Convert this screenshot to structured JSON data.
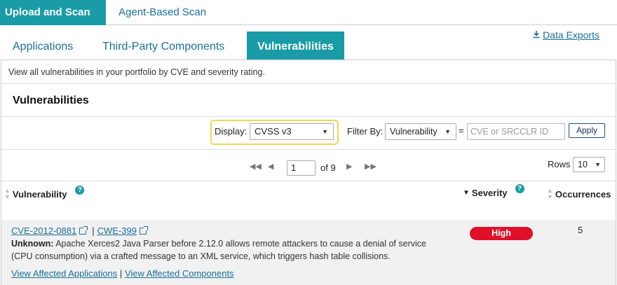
{
  "top_tabs": {
    "upload_scan": "Upload and Scan",
    "agent_scan": "Agent-Based Scan"
  },
  "sub_tabs": {
    "applications": "Applications",
    "third_party": "Third-Party Components",
    "vulnerabilities": "Vulnerabilities"
  },
  "data_exports": "Data Exports",
  "description": "View all vulnerabilities in your portfolio by CVE and severity rating.",
  "section_title": "Vulnerabilities",
  "filters": {
    "display_label": "Display:",
    "display_value": "CVSS v3",
    "filter_by_label": "Filter By:",
    "filter_by_value": "Vulnerability",
    "equals": "=",
    "search_placeholder": "CVE or SRCCLR ID",
    "apply_label": "Apply"
  },
  "pagination": {
    "current_page": "1",
    "of_label": "of 9",
    "rows_label": "Rows",
    "rows_value": "10"
  },
  "columns": {
    "vulnerability": "Vulnerability",
    "severity": "Severity",
    "occurrences": "Occurrences"
  },
  "rows": [
    {
      "cve": "CVE-2012-0881",
      "cwe": "CWE-399",
      "sep": "|",
      "desc_prefix": "Unknown:",
      "description": "Apache Xerces2 Java Parser before 2.12.0 allows remote attackers to cause a denial of service (CPU consumption) via a crafted message to an XML service, which triggers hash table collisions.",
      "view_apps": "View Affected Applications",
      "view_components": "View Affected Components",
      "link_sep": "|",
      "severity": "High",
      "occurrences": "5"
    }
  ],
  "colors": {
    "accent": "#1a9ba8",
    "link": "#1a6f9a",
    "high": "#e0102a",
    "highlight": "#f0d94a"
  }
}
